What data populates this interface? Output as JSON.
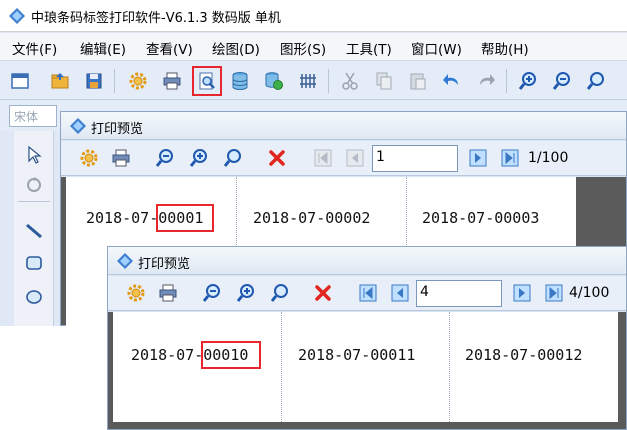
{
  "app": {
    "title": "中琅条码标签打印软件-V6.1.3 数码版 单机",
    "menu": [
      {
        "label": "文件(F)"
      },
      {
        "label": "编辑(E)"
      },
      {
        "label": "查看(V)"
      },
      {
        "label": "绘图(D)"
      },
      {
        "label": "图形(S)"
      },
      {
        "label": "工具(T)"
      },
      {
        "label": "窗口(W)"
      },
      {
        "label": "帮助(H)"
      }
    ],
    "font_name": "宋体",
    "toolbar_icons": [
      "new-window-icon",
      "open-folder-icon",
      "save-icon",
      "settings-icon",
      "printer-icon",
      "print-preview-icon",
      "database-icon",
      "database-settings-icon",
      "barcode-grid-icon",
      "cut-icon",
      "copy-icon",
      "paste-icon",
      "undo-icon",
      "redo-icon",
      "zoom-in-icon",
      "zoom-out-icon",
      "zoom-fit-icon"
    ],
    "highlight_color": "#e8262e"
  },
  "preview1": {
    "title": "打印预览",
    "page_value": "1",
    "page_count": "1/100",
    "labels": [
      "2018-07-00001",
      "2018-07-00002",
      "2018-07-00003"
    ],
    "highlight_text": "00001"
  },
  "preview2": {
    "title": "打印预览",
    "page_value": "4",
    "page_count": "4/100",
    "labels": [
      "2018-07-00010",
      "2018-07-00011",
      "2018-07-00012"
    ],
    "highlight_text": "00010"
  }
}
